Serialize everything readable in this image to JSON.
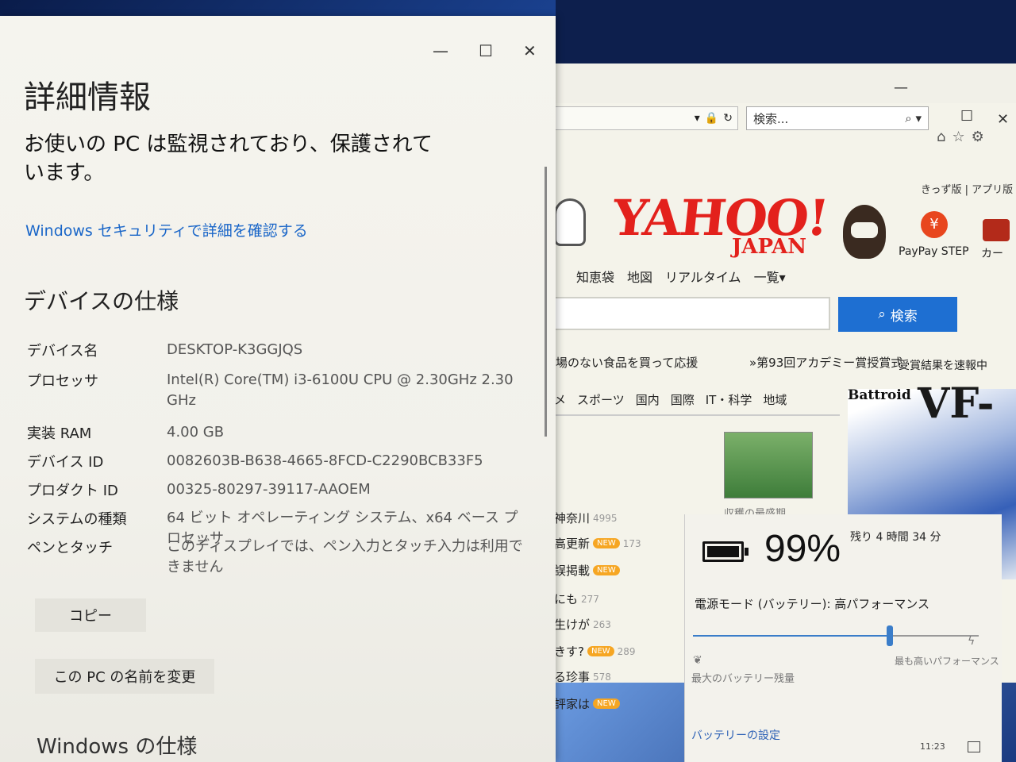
{
  "about": {
    "title": "詳細情報",
    "protection_text": "お使いの PC は監視されており、保護されています。",
    "security_link": "Windows セキュリティで詳細を確認する",
    "specs_heading": "デバイスの仕様",
    "specs": [
      {
        "label": "デバイス名",
        "value": "DESKTOP-K3GGJQS"
      },
      {
        "label": "プロセッサ",
        "value": "Intel(R) Core(TM) i3-6100U CPU @ 2.30GHz   2.30 GHz"
      },
      {
        "label": "実装 RAM",
        "value": "4.00 GB"
      },
      {
        "label": "デバイス ID",
        "value": "0082603B-B638-4665-8FCD-C2290BCB33F5"
      },
      {
        "label": "プロダクト ID",
        "value": "00325-80297-39117-AAOEM"
      },
      {
        "label": "システムの種類",
        "value": "64 ビット オペレーティング システム、x64 ベース プロセッサ"
      },
      {
        "label": "ペンとタッチ",
        "value": "このディスプレイでは、ペン入力とタッチ入力は利用できません"
      }
    ],
    "copy_button": "コピー",
    "rename_button": "この PC の名前を変更",
    "windows_heading": "Windows の仕様",
    "controls": {
      "minimize": "—",
      "maximize": "☐",
      "close": "✕"
    }
  },
  "browser": {
    "search_placeholder": "検索...",
    "util_links": "きっず版 | アプリ版",
    "logo": "YAHOO!",
    "logo_sub": "JAPAN",
    "paypay_label": "PayPay STEP",
    "car_label": "カー",
    "nav": [
      "知恵袋",
      "地図",
      "リアルタイム",
      "一覧▾"
    ],
    "search_button": "検索",
    "ad_text": "場のない食品を買って応援",
    "ad_text2": "»第93回アカデミー賞授賞式",
    "ad_text3": "受賞結果を速報中",
    "news_tabs": [
      "メ",
      "スポーツ",
      "国内",
      "国際",
      "IT・科学",
      "地域"
    ],
    "news_items": [
      {
        "text": "神奈川",
        "count": "4995",
        "badge": ""
      },
      {
        "text": "高更新",
        "count": "173",
        "badge": "NEW"
      },
      {
        "text": "誤掲載",
        "count": "",
        "badge": "NEW"
      },
      {
        "text": "にも",
        "count": "277",
        "badge": ""
      },
      {
        "text": "生けが",
        "count": "263",
        "badge": ""
      },
      {
        "text": "きす?",
        "count": "289",
        "badge": "NEW"
      },
      {
        "text": "る珍事",
        "count": "578",
        "badge": ""
      },
      {
        "text": "評家は",
        "count": "",
        "badge": "NEW"
      }
    ],
    "photo_caption": "収穫の最盛期",
    "battroid_title": "Battroid",
    "vf_title": "VF-"
  },
  "battery": {
    "percent": "99%",
    "remaining": "残り 4 時間 34 分",
    "power_mode": "電源モード (バッテリー): 高パフォーマンス",
    "slider_level": 0.69,
    "left_label": "最大のバッテリー残量",
    "right_label": "最も高いパフォーマンス",
    "settings_link": "バッテリーの設定",
    "time": "11:23"
  }
}
